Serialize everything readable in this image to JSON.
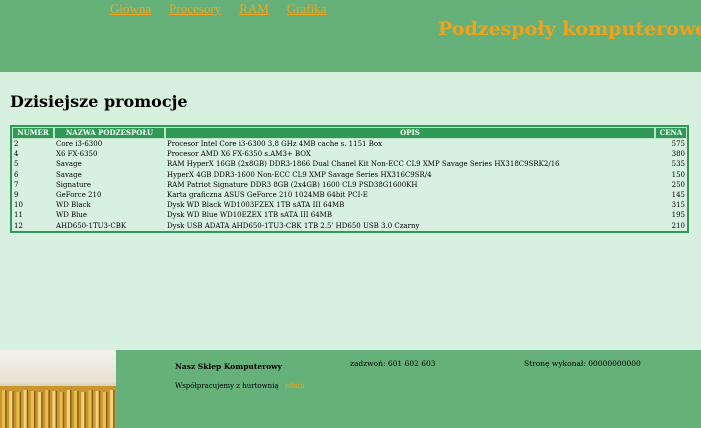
{
  "nav": {
    "items": [
      {
        "label": "Główna"
      },
      {
        "label": "Procesory"
      },
      {
        "label": "RAM"
      },
      {
        "label": "Grafika"
      }
    ]
  },
  "header": {
    "title": "Podzespoły komputerowe"
  },
  "main": {
    "title": "Dzisiejsze promocje",
    "table": {
      "columns": [
        "NUMER",
        "NAZWA PODZESPOŁU",
        "OPIS",
        "CENA"
      ],
      "rows": [
        {
          "numer": "2",
          "nazwa": "Core i3-6300",
          "opis": "Procesor Intel Core i3-6300 3,8 GHz 4MB cache s. 1151 Box",
          "cena": "575"
        },
        {
          "numer": "4",
          "nazwa": "X6 FX-6350",
          "opis": "Procesor AMD X6 FX-6350 s.AM3+ BOX",
          "cena": "380"
        },
        {
          "numer": "5",
          "nazwa": "Savage",
          "opis": "RAM HyperX 16GB (2x8GB) DDR3-1866 Dual Chanel Kit Non-ECC CL9 XMP Savage Series HX318C9SRK2/16",
          "cena": "535"
        },
        {
          "numer": "6",
          "nazwa": "Savage",
          "opis": "HyperX 4GB DDR3-1600 Non-ECC CL9 XMP Savage Series HX316C9SR/4",
          "cena": "150"
        },
        {
          "numer": "7",
          "nazwa": "Signature",
          "opis": "RAM Patriot Signature DDR3 8GB (2x4GB) 1600 CL9 PSD38G1600KH",
          "cena": "250"
        },
        {
          "numer": "9",
          "nazwa": "GeForce 210",
          "opis": "Karta graficzna ASUS GeForce 210 1024MB 64bit PCI-E",
          "cena": "145"
        },
        {
          "numer": "10",
          "nazwa": "WD Black",
          "opis": "Dysk WD Black WD1003FZEX 1TB sATA III 64MB",
          "cena": "315"
        },
        {
          "numer": "11",
          "nazwa": "WD Blue",
          "opis": "Dysk WD Blue WD10EZEX 1TB sATA III 64MB",
          "cena": "195"
        },
        {
          "numer": "12",
          "nazwa": "AHD650-1TU3-CBK",
          "opis": "Dysk USB ADATA AHD650-1TU3-CBK 1TB 2.5' HD650 USB 3.0 Czarny",
          "cena": "210"
        }
      ]
    }
  },
  "footer": {
    "shop_name": "Nasz Sklep Komputerowy",
    "phone": "zadzwoń: 601 602 603",
    "author": "Stronę wykonał: 00000000000",
    "coop_text": "Współpracujemy z hurtownią",
    "coop_link": "edata"
  },
  "colors": {
    "header_bg": "#66b17a",
    "page_bg": "#d8f0e0",
    "accent": "#f1a21b",
    "table_header_bg": "#2f9a55"
  },
  "icons": {
    "footer_image": "cpu-pins-image"
  }
}
